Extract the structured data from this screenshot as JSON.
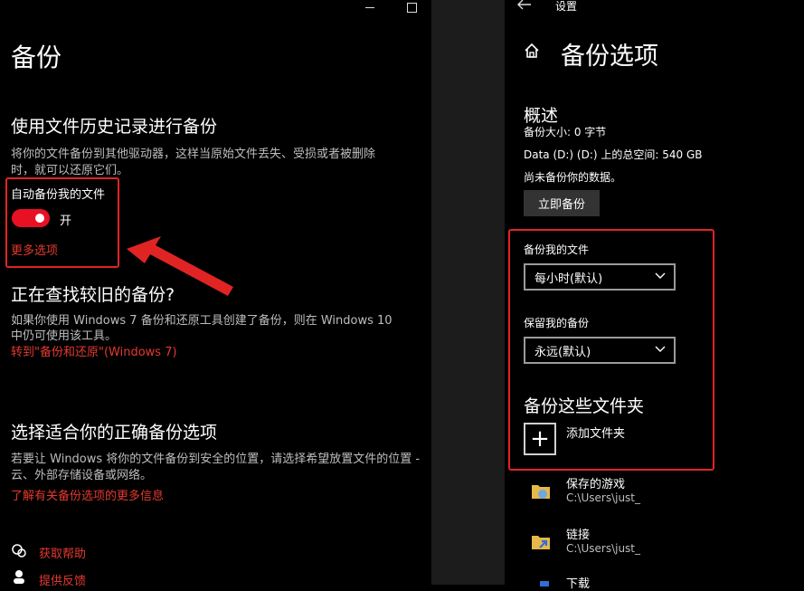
{
  "left": {
    "title": "备份",
    "section1": {
      "heading": "使用文件历史记录进行备份",
      "desc_line1": "将你的文件备份到其他驱动器，这样当原始文件丢失、受损或者被删除",
      "desc_line2": "时，就可以还原它们。",
      "toggle_label": "自动备份我的文件",
      "toggle_state": "开",
      "more_options": "更多选项"
    },
    "section2": {
      "heading": "正在查找较旧的备份?",
      "desc_line1": "如果你使用 Windows 7 备份和还原工具创建了备份，则在 Windows 10",
      "desc_line2": "中仍可使用该工具。",
      "link": "转到\"备份和还原\"(Windows 7)"
    },
    "section3": {
      "heading": "选择适合你的正确备份选项",
      "desc_line1": "若要让 Windows 将你的文件备份到安全的位置，请选择希望放置文件的位置 -",
      "desc_line2": "云、外部存储设备或网络。",
      "link": "了解有关备份选项的更多信息"
    },
    "footer": {
      "help": "获取帮助",
      "feedback": "提供反馈"
    }
  },
  "right": {
    "app_title": "设置",
    "page_title": "备份选项",
    "overview": {
      "heading": "概述",
      "size": "备份大小: 0 字节",
      "space": "Data (D:) (D:) 上的总空间: 540 GB",
      "status": "尚未备份你的数据。",
      "backup_now": "立即备份"
    },
    "backup_files_label": "备份我的文件",
    "backup_frequency": "每小时(默认)",
    "keep_label": "保留我的备份",
    "keep_value": "永远(默认)",
    "folders_heading": "备份这些文件夹",
    "add_folder": "添加文件夹",
    "folders": [
      {
        "name": "保存的游戏",
        "path": "C:\\Users\\just_"
      },
      {
        "name": "链接",
        "path": "C:\\Users\\just_"
      },
      {
        "name": "下载",
        "path": ""
      }
    ]
  },
  "colors": {
    "accent_red": "#e81123",
    "annotation_red": "#e02424",
    "link_red": "#e5392f"
  }
}
